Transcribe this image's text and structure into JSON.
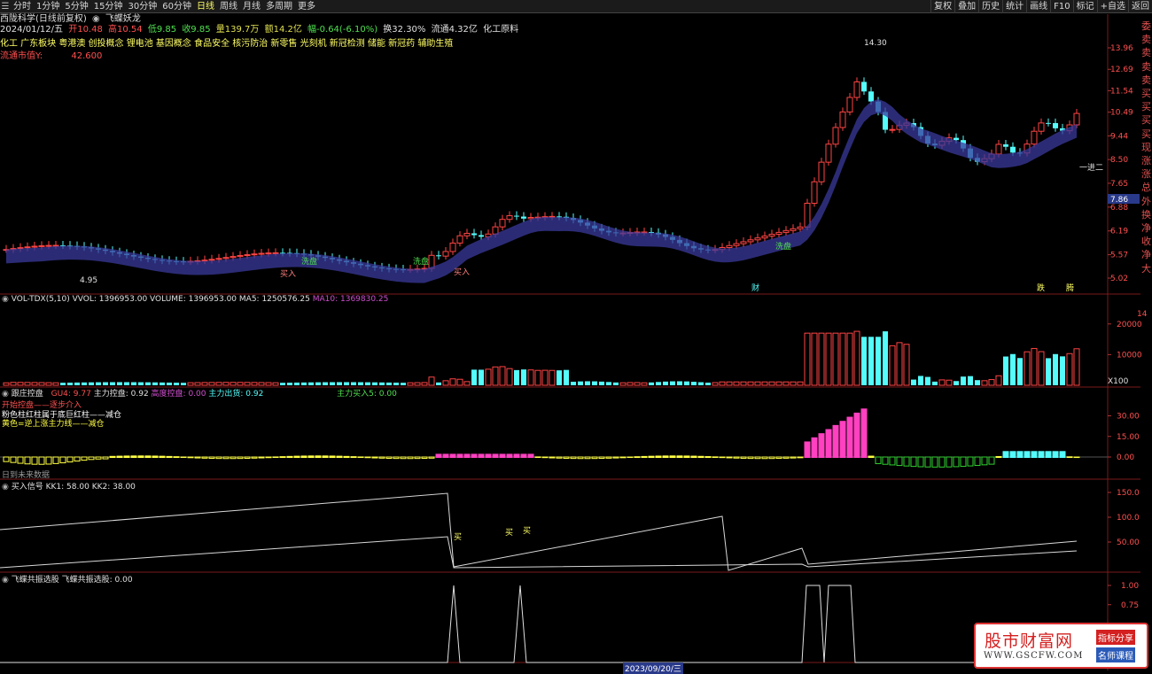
{
  "toolbar": {
    "items": [
      "分时",
      "1分钟",
      "5分钟",
      "15分钟",
      "30分钟",
      "60分钟",
      "日线",
      "周线",
      "月线",
      "多周期",
      "更多"
    ],
    "active": "日线",
    "right": [
      "复权",
      "叠加",
      "历史",
      "统计",
      "画线",
      "F10",
      "标记",
      "+自选",
      "返回"
    ]
  },
  "header": {
    "stock": "西陇科学(日线前复权)",
    "formula": "飞蝶妖龙",
    "date": "2024/01/12/五",
    "open": "开10.48",
    "high": "高10.54",
    "low": "低9.85",
    "close": "收9.85",
    "volume": "量139.7万",
    "amount": "额14.2亿",
    "change": "幅-0.64(-6.10%)",
    "turnover": "换32.30%",
    "float_shares": "流通4.32亿",
    "industry": "化工原料",
    "concepts": "化工 广东板块 粤港澳 创投概念 锂电池 基因概念 食品安全 核污防治 新零售 光刻机 新冠检测 储能 新冠药 辅助生殖",
    "market_value_label": "流通市值Y:",
    "market_value": "42.600"
  },
  "side_labels": [
    "委",
    "卖",
    "卖",
    "卖",
    "卖",
    "买",
    "买",
    "买",
    "买",
    "现",
    "涨",
    "涨",
    "总",
    "外",
    "换",
    "净",
    "收",
    "净",
    "大"
  ],
  "colors": {
    "up": "#ff4444",
    "down": "#54fcfc",
    "green": "#1e8a1e",
    "blue": "#3a3a9c",
    "grid": "#6a1010"
  },
  "main_panel": {
    "y_ticks": [
      "13.96",
      "12.69",
      "11.54",
      "10.49",
      "9.44",
      "8.50",
      "7.65",
      "6.88",
      "6.19",
      "5.57",
      "5.02"
    ],
    "y_values": [
      13.96,
      12.69,
      11.54,
      10.49,
      9.44,
      8.5,
      7.65,
      6.88,
      6.19,
      5.57,
      5.02
    ],
    "current_price": "7.86",
    "high_label": "14.30",
    "low_label": "4.95",
    "markers": [
      "洗盘",
      "洗盘",
      "洗盘",
      "买入",
      "买入",
      "财",
      "跌",
      "腾",
      "一进二"
    ]
  },
  "vol_panel": {
    "title": "VOL-TDX(5,10)",
    "vol": "VVOL: 1396953.00",
    "volume": "VOLUME: 1396953.00",
    "ma5": "MA5: 1250576.25",
    "ma10": "MA10: 1369830.25",
    "y_ticks": [
      "20000",
      "10000"
    ],
    "y_values": [
      20000,
      10000
    ],
    "right_top": "14",
    "unit": "X100"
  },
  "ctrl_panel": {
    "title": "跟庄控盘",
    "gu4": "GU4: 9.77",
    "zlkp": "主力控盘: 0.92",
    "gdkp": "高度控盘: 0.00",
    "zlcx": "主力出货: 0.92",
    "zlmr5": "主力买入5: 0.00",
    "legend1": "开始控盘——逐步介入",
    "legend2": "粉色柱红柱属于底巨红柱——减仓",
    "legend3": "黄色=逆上涨主力线——减仓",
    "y_ticks": [
      "30.00",
      "15.00",
      "0.00"
    ],
    "y_values": [
      30,
      15,
      0
    ],
    "no_data": "日到未来数据"
  },
  "buy_panel": {
    "title": "买入信号",
    "kk1": "KK1: 58.00",
    "kk2": "KK2: 38.00",
    "y_ticks": [
      "150.0",
      "100.0",
      "50.00"
    ],
    "y_values": [
      150,
      100,
      50
    ],
    "mark": "买"
  },
  "fly_panel": {
    "title": "飞蝶共振选股",
    "value": "飞蝶共振选股: 0.00",
    "y_ticks": [
      "1.00",
      "0.75"
    ],
    "y_values": [
      1,
      0.75
    ]
  },
  "date_axis": {
    "selected": "2023/09/20/三"
  },
  "watermark": {
    "brand": "股市财富网",
    "url": "WWW.GSCFW.COM",
    "tag1": "指标分享",
    "tag2": "名师课程"
  }
}
